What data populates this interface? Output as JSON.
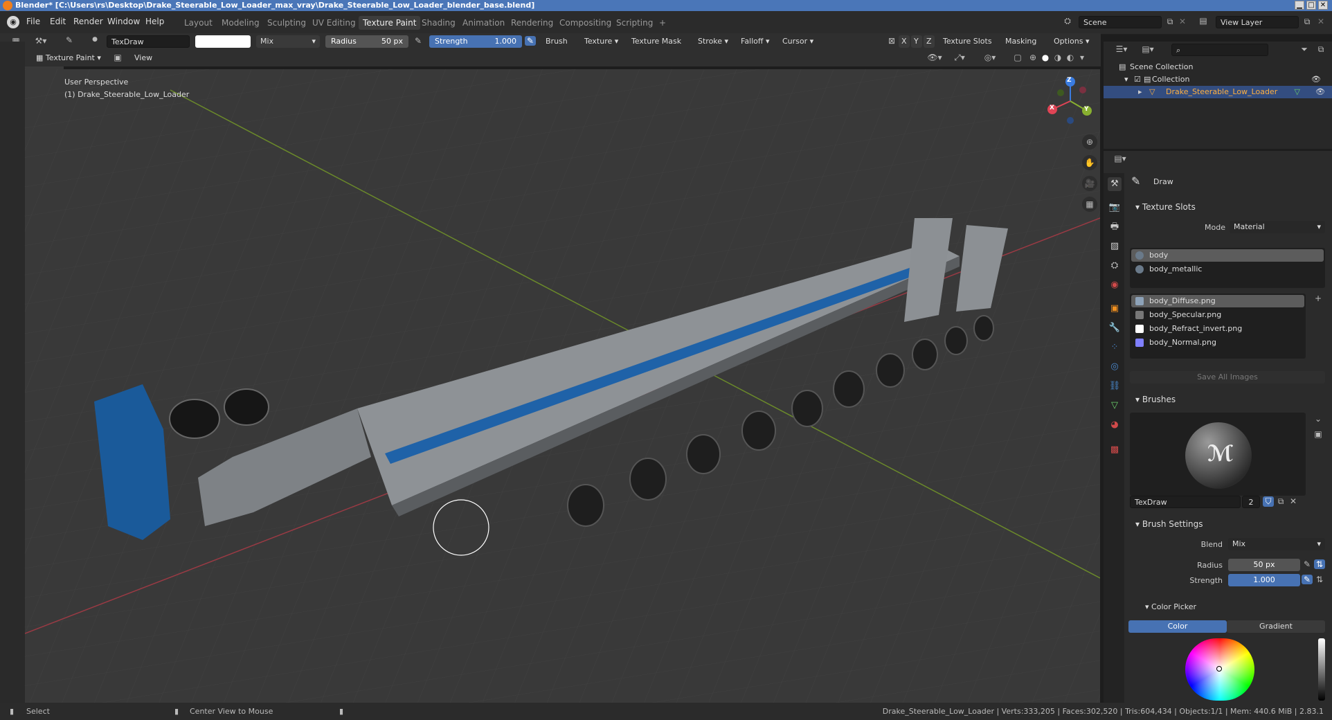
{
  "window": {
    "title": "Blender* [C:\\Users\\rs\\Desktop\\Drake_Steerable_Low_Loader_max_vray\\Drake_Steerable_Low_Loader_blender_base.blend]",
    "minimize": "▁",
    "maximize": "□",
    "close": "✕"
  },
  "menu": [
    "File",
    "Edit",
    "Render",
    "Window",
    "Help"
  ],
  "workspaces": [
    "Layout",
    "Modeling",
    "Sculpting",
    "UV Editing",
    "Texture Paint",
    "Shading",
    "Animation",
    "Rendering",
    "Compositing",
    "Scripting",
    "+"
  ],
  "active_workspace": "Texture Paint",
  "scene": {
    "name": "Scene",
    "view_layer": "View Layer"
  },
  "tool_header": {
    "brush_name": "TexDraw",
    "blend": "Mix",
    "radius_label": "Radius",
    "radius_value": "50 px",
    "strength_label": "Strength",
    "strength_value": "1.000",
    "strength_fraction": 1.0,
    "menus": [
      "Brush",
      "Texture",
      "Texture Mask",
      "Stroke",
      "Falloff",
      "Cursor"
    ],
    "axes": [
      "X",
      "Y",
      "Z"
    ],
    "right_menus": [
      "Texture Slots",
      "Masking",
      "Options"
    ]
  },
  "view_header": {
    "mode": "Texture Paint",
    "view": "View"
  },
  "viewport": {
    "perspective": "User Perspective",
    "object_label": "(1) Drake_Steerable_Low_Loader",
    "gizmo": {
      "z": "Z",
      "x": "X",
      "y": "Y"
    }
  },
  "outliner": {
    "root": "Scene Collection",
    "collection": "Collection",
    "object": "Drake_Steerable_Low_Loader"
  },
  "properties": {
    "tool_name": "Draw",
    "texture_slots": {
      "header": "Texture Slots",
      "mode_label": "Mode",
      "mode_value": "Material",
      "materials": [
        "body",
        "body_metallic"
      ],
      "images": [
        {
          "name": "body_Diffuse.png",
          "color": "#8da2b8"
        },
        {
          "name": "body_Specular.png",
          "color": "#777777"
        },
        {
          "name": "body_Refract_invert.png",
          "color": "#ffffff"
        },
        {
          "name": "body_Normal.png",
          "color": "#8080ff"
        }
      ],
      "save_all": "Save All Images"
    },
    "brushes": {
      "header": "Brushes",
      "name": "TexDraw",
      "users": "2"
    },
    "brush_settings": {
      "header": "Brush Settings",
      "blend_label": "Blend",
      "blend_value": "Mix",
      "radius_label": "Radius",
      "radius_value": "50 px",
      "strength_label": "Strength",
      "strength_value": "1.000"
    },
    "color_picker": {
      "header": "Color Picker",
      "tabs": [
        "Color",
        "Gradient"
      ],
      "active": "Color"
    }
  },
  "status": {
    "select": "Select",
    "center_view": "Center View to Mouse",
    "stats": "Drake_Steerable_Low_Loader | Verts:333,205 | Faces:302,520 | Tris:604,434 | Objects:1/1 | Mem: 440.6 MiB | 2.83.1"
  },
  "colors": {
    "accent": "#4772b3",
    "trailer_blue": "#1f62a8",
    "deck_grey": "#8e9296",
    "x_axis": "#e04455",
    "y_axis": "#88b030",
    "z_axis": "#3a7ce0"
  }
}
